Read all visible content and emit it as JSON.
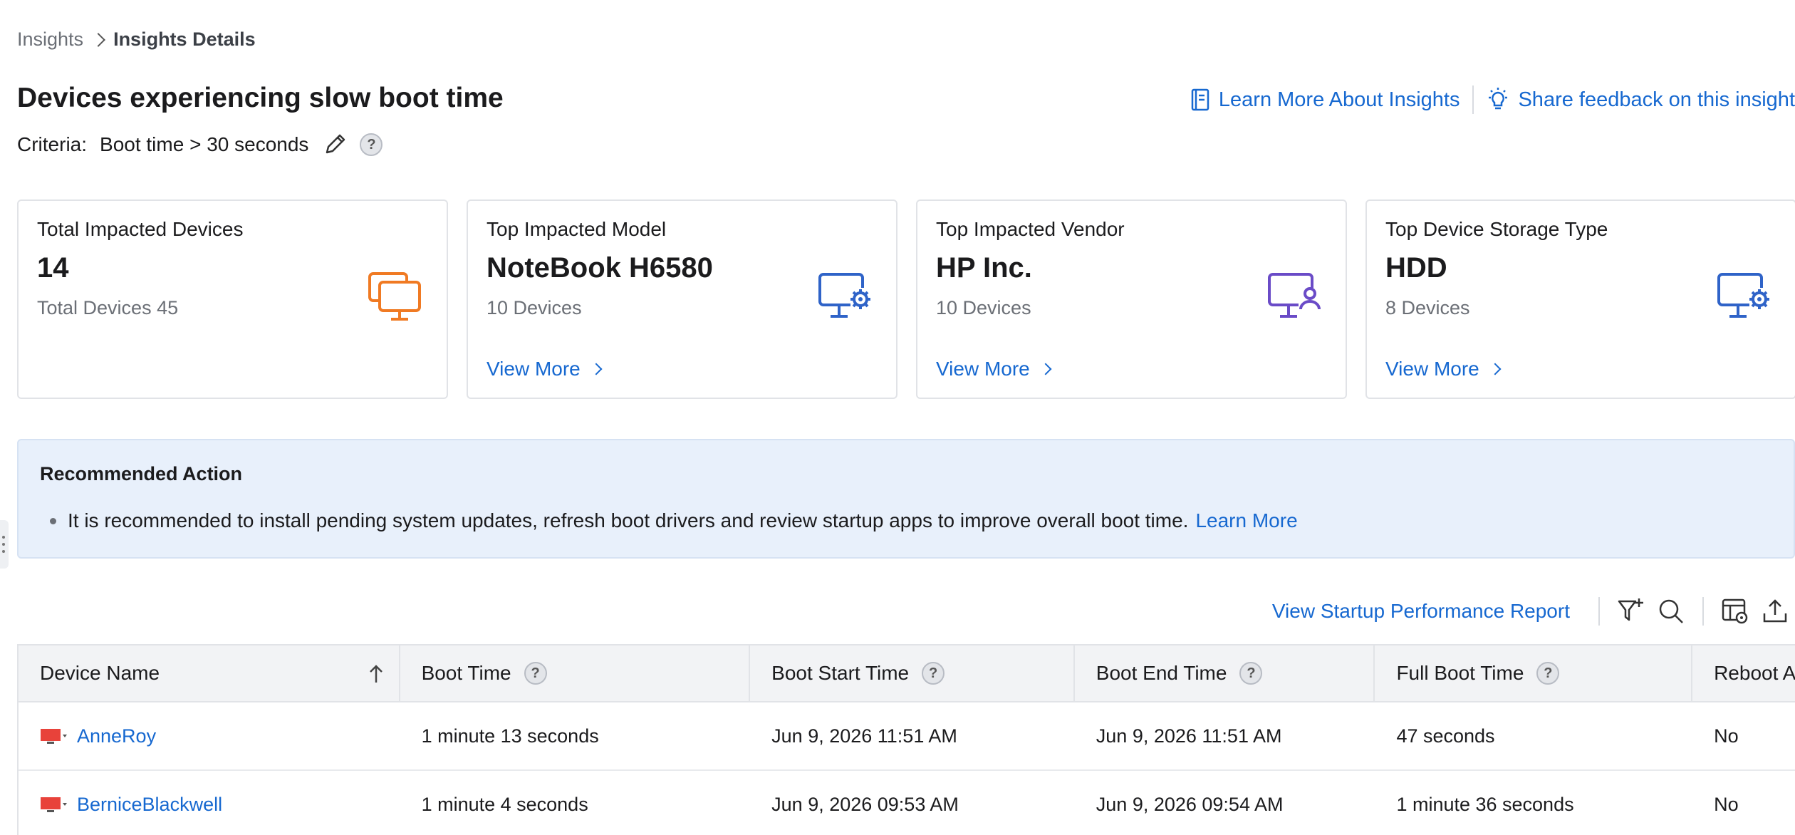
{
  "breadcrumb": {
    "root": "Insights",
    "current": "Insights Details"
  },
  "page": {
    "title": "Devices experiencing slow boot time",
    "criteria_label": "Criteria:",
    "criteria_value": "Boot time > 30 seconds",
    "help": "?"
  },
  "header_links": {
    "learn_more": "Learn More About Insights",
    "feedback": "Share feedback on this insight"
  },
  "cards": [
    {
      "label": "Total Impacted Devices",
      "value": "14",
      "sub": "Total Devices 45",
      "link": "",
      "icon": "monitors-icon",
      "icon_color": "#f07a23"
    },
    {
      "label": "Top Impacted Model",
      "value": "NoteBook H6580",
      "sub": "10 Devices",
      "link": "View More",
      "icon": "monitor-gear-icon",
      "icon_color": "#2f63c8"
    },
    {
      "label": "Top Impacted Vendor",
      "value": "HP Inc.",
      "sub": "10 Devices",
      "link": "View More",
      "icon": "monitor-user-icon",
      "icon_color": "#6a4bc7"
    },
    {
      "label": "Top Device Storage Type",
      "value": "HDD",
      "sub": "8 Devices",
      "link": "View More",
      "icon": "monitor-gear-icon",
      "icon_color": "#2f63c8"
    }
  ],
  "recommendation": {
    "title": "Recommended Action",
    "text": "It is recommended to install pending system updates, refresh boot drivers and review startup apps to improve overall boot time.",
    "link": "Learn More"
  },
  "toolbar": {
    "report_link": "View Startup Performance Report"
  },
  "table": {
    "columns": [
      "Device Name",
      "Boot Time",
      "Boot Start Time",
      "Boot End Time",
      "Full Boot Time",
      "Reboot A"
    ],
    "rows": [
      {
        "device": "AnneRoy",
        "boot_time": "1 minute 13 seconds",
        "start": "Jun 9, 2026 11:51 AM",
        "end": "Jun 9, 2026 11:51 AM",
        "full": "47 seconds",
        "reboot": "No"
      },
      {
        "device": "BerniceBlackwell",
        "boot_time": "1 minute 4 seconds",
        "start": "Jun 9, 2026 09:53 AM",
        "end": "Jun 9, 2026 09:54 AM",
        "full": "1 minute 36 seconds",
        "reboot": "No"
      }
    ]
  },
  "colors": {
    "link": "#1668d0",
    "device_icon": "#e8423a",
    "banner_bg": "#e8f0fb"
  }
}
